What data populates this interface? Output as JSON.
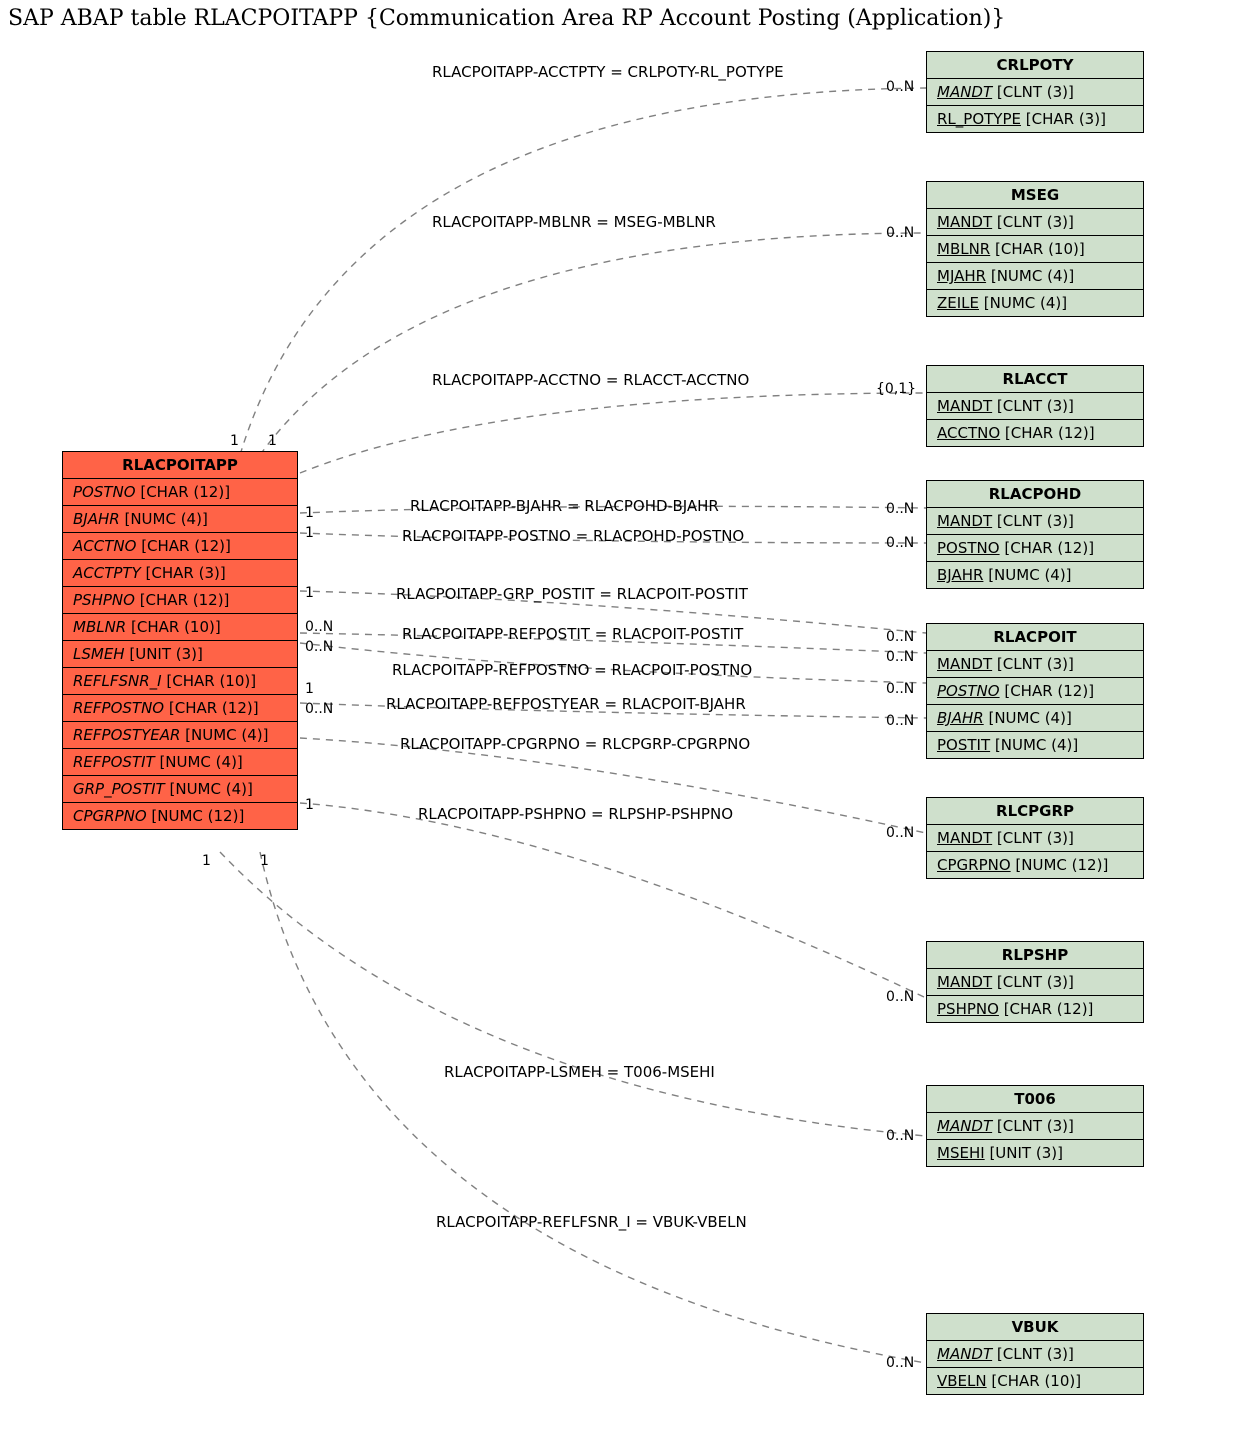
{
  "title": "SAP ABAP table RLACPOITAPP {Communication Area RP Account Posting (Application)}",
  "main_entity": {
    "name": "RLACPOITAPP",
    "fields": [
      {
        "name": "POSTNO",
        "type": "[CHAR (12)]",
        "italic": true
      },
      {
        "name": "BJAHR",
        "type": "[NUMC (4)]",
        "italic": true
      },
      {
        "name": "ACCTNO",
        "type": "[CHAR (12)]",
        "italic": true
      },
      {
        "name": "ACCTPTY",
        "type": "[CHAR (3)]",
        "italic": true
      },
      {
        "name": "PSHPNO",
        "type": "[CHAR (12)]",
        "italic": true
      },
      {
        "name": "MBLNR",
        "type": "[CHAR (10)]",
        "italic": true
      },
      {
        "name": "LSMEH",
        "type": "[UNIT (3)]",
        "italic": true
      },
      {
        "name": "REFLFSNR_I",
        "type": "[CHAR (10)]",
        "italic": true
      },
      {
        "name": "REFPOSTNO",
        "type": "[CHAR (12)]",
        "italic": true
      },
      {
        "name": "REFPOSTYEAR",
        "type": "[NUMC (4)]",
        "italic": true
      },
      {
        "name": "REFPOSTIT",
        "type": "[NUMC (4)]",
        "italic": true
      },
      {
        "name": "GRP_POSTIT",
        "type": "[NUMC (4)]",
        "italic": true
      },
      {
        "name": "CPGRPNO",
        "type": "[NUMC (12)]",
        "italic": true
      }
    ]
  },
  "ref_entities": [
    {
      "name": "CRLPOTY",
      "fields": [
        {
          "name": "MANDT",
          "type": "[CLNT (3)]",
          "italic": true,
          "under": true
        },
        {
          "name": "RL_POTYPE",
          "type": "[CHAR (3)]",
          "under": true
        }
      ]
    },
    {
      "name": "MSEG",
      "fields": [
        {
          "name": "MANDT",
          "type": "[CLNT (3)]",
          "under": true
        },
        {
          "name": "MBLNR",
          "type": "[CHAR (10)]",
          "under": true
        },
        {
          "name": "MJAHR",
          "type": "[NUMC (4)]",
          "under": true
        },
        {
          "name": "ZEILE",
          "type": "[NUMC (4)]",
          "under": true
        }
      ]
    },
    {
      "name": "RLACCT",
      "fields": [
        {
          "name": "MANDT",
          "type": "[CLNT (3)]",
          "under": true
        },
        {
          "name": "ACCTNO",
          "type": "[CHAR (12)]",
          "under": true
        }
      ]
    },
    {
      "name": "RLACPOHD",
      "fields": [
        {
          "name": "MANDT",
          "type": "[CLNT (3)]",
          "under": true
        },
        {
          "name": "POSTNO",
          "type": "[CHAR (12)]",
          "under": true
        },
        {
          "name": "BJAHR",
          "type": "[NUMC (4)]",
          "under": true
        }
      ]
    },
    {
      "name": "RLACPOIT",
      "fields": [
        {
          "name": "MANDT",
          "type": "[CLNT (3)]",
          "under": true
        },
        {
          "name": "POSTNO",
          "type": "[CHAR (12)]",
          "italic": true,
          "under": true
        },
        {
          "name": "BJAHR",
          "type": "[NUMC (4)]",
          "italic": true,
          "under": true
        },
        {
          "name": "POSTIT",
          "type": "[NUMC (4)]",
          "under": true
        }
      ]
    },
    {
      "name": "RLCPGRP",
      "fields": [
        {
          "name": "MANDT",
          "type": "[CLNT (3)]",
          "under": true
        },
        {
          "name": "CPGRPNO",
          "type": "[NUMC (12)]",
          "under": true
        }
      ]
    },
    {
      "name": "RLPSHP",
      "fields": [
        {
          "name": "MANDT",
          "type": "[CLNT (3)]",
          "under": true
        },
        {
          "name": "PSHPNO",
          "type": "[CHAR (12)]",
          "under": true
        }
      ]
    },
    {
      "name": "T006",
      "fields": [
        {
          "name": "MANDT",
          "type": "[CLNT (3)]",
          "italic": true,
          "under": true
        },
        {
          "name": "MSEHI",
          "type": "[UNIT (3)]",
          "under": true
        }
      ]
    },
    {
      "name": "VBUK",
      "fields": [
        {
          "name": "MANDT",
          "type": "[CLNT (3)]",
          "italic": true,
          "under": true
        },
        {
          "name": "VBELN",
          "type": "[CHAR (10)]",
          "under": true
        }
      ]
    }
  ],
  "relations": [
    {
      "label": "RLACPOITAPP-ACCTPTY = CRLPOTY-RL_POTYPE",
      "left_card": "1",
      "right_card": "0..N"
    },
    {
      "label": "RLACPOITAPP-MBLNR = MSEG-MBLNR",
      "left_card": "1",
      "right_card": "0..N"
    },
    {
      "label": "RLACPOITAPP-ACCTNO = RLACCT-ACCTNO",
      "left_card": "",
      "right_card": "{0,1}"
    },
    {
      "label": "RLACPOITAPP-BJAHR = RLACPOHD-BJAHR",
      "left_card": "1",
      "right_card": "0..N"
    },
    {
      "label": "RLACPOITAPP-POSTNO = RLACPOHD-POSTNO",
      "left_card": "1",
      "right_card": "0..N"
    },
    {
      "label": "RLACPOITAPP-GRP_POSTIT = RLACPOIT-POSTIT",
      "left_card": "1",
      "right_card": ""
    },
    {
      "label": "RLACPOITAPP-REFPOSTIT = RLACPOIT-POSTIT",
      "left_card": "0..N",
      "right_card": "0..N"
    },
    {
      "label": "RLACPOITAPP-REFPOSTNO = RLACPOIT-POSTNO",
      "left_card": "0..N",
      "right_card": "0..N"
    },
    {
      "label": "RLACPOITAPP-REFPOSTYEAR = RLACPOIT-BJAHR",
      "left_card": "1",
      "right_card": "0..N"
    },
    {
      "label": "RLACPOITAPP-CPGRPNO = RLCPGRP-CPGRPNO",
      "left_card": "0..N",
      "right_card": "0..N"
    },
    {
      "label": "RLACPOITAPP-PSHPNO = RLPSHP-PSHPNO",
      "left_card": "1",
      "right_card": "0..N"
    },
    {
      "label": "RLACPOITAPP-LSMEH = T006-MSEHI",
      "left_card": "1",
      "right_card": "0..N"
    },
    {
      "label": "RLACPOITAPP-REFLFSNR_I = VBUK-VBELN",
      "left_card": "1",
      "right_card": "0..N"
    }
  ]
}
